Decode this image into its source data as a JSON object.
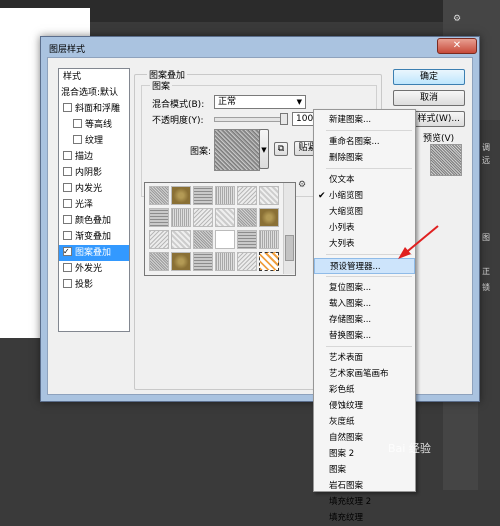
{
  "dialog": {
    "title": "图层样式",
    "close_label": "✕"
  },
  "style_list": {
    "header": "样式",
    "blend_options": "混合选项:默认",
    "items": [
      {
        "label": "斜面和浮雕",
        "checked": false
      },
      {
        "label": "等高线",
        "checked": false
      },
      {
        "label": "纹理",
        "checked": false
      },
      {
        "label": "描边",
        "checked": false
      },
      {
        "label": "内阴影",
        "checked": false
      },
      {
        "label": "内发光",
        "checked": false
      },
      {
        "label": "光泽",
        "checked": false
      },
      {
        "label": "颜色叠加",
        "checked": false
      },
      {
        "label": "渐变叠加",
        "checked": false
      },
      {
        "label": "图案叠加",
        "checked": true,
        "selected": true
      },
      {
        "label": "外发光",
        "checked": false
      },
      {
        "label": "投影",
        "checked": false
      }
    ]
  },
  "pattern_overlay": {
    "group_title": "图案叠加",
    "subgroup_title": "图案",
    "blend_mode_label": "混合模式(B):",
    "blend_mode_value": "正常",
    "opacity_label": "不透明度(Y):",
    "opacity_value": "100",
    "pattern_label": "图案:",
    "snap_button": "贴紧原"
  },
  "buttons": {
    "ok": "确定",
    "cancel": "取消",
    "new_style": "样式(W)...",
    "preview": "预览(V)"
  },
  "context_menu": {
    "items": [
      {
        "label": "新建图案...",
        "checked": false
      },
      {
        "separator": true
      },
      {
        "label": "重命名图案...",
        "checked": false
      },
      {
        "label": "删除图案",
        "checked": false
      },
      {
        "separator": true
      },
      {
        "label": "仅文本",
        "checked": false
      },
      {
        "label": "小缩览图",
        "checked": true
      },
      {
        "label": "大缩览图",
        "checked": false
      },
      {
        "label": "小列表",
        "checked": false
      },
      {
        "label": "大列表",
        "checked": false
      },
      {
        "separator": true
      },
      {
        "label": "预设管理器...",
        "checked": false,
        "highlighted": true
      },
      {
        "separator": true
      },
      {
        "label": "复位图案...",
        "checked": false
      },
      {
        "label": "载入图案...",
        "checked": false
      },
      {
        "label": "存储图案...",
        "checked": false
      },
      {
        "label": "替换图案...",
        "checked": false
      },
      {
        "separator": true
      },
      {
        "label": "艺术表面",
        "checked": false
      },
      {
        "label": "艺术家画笔画布",
        "checked": false
      },
      {
        "label": "彩色纸",
        "checked": false
      },
      {
        "label": "侵蚀纹理",
        "checked": false
      },
      {
        "label": "灰度纸",
        "checked": false
      },
      {
        "label": "自然图案",
        "checked": false
      },
      {
        "label": "图案 2",
        "checked": false
      },
      {
        "label": "图案",
        "checked": false
      },
      {
        "label": "岩石图案",
        "checked": false
      },
      {
        "label": "填充纹理 2",
        "checked": false
      },
      {
        "label": "填充纹理",
        "checked": false
      }
    ]
  },
  "background_panel": {
    "labels": [
      "调",
      "远",
      "图",
      "正",
      "锁"
    ]
  },
  "watermark": "Bai 经验",
  "colors": {
    "accent": "#3399ff",
    "arrow": "#e02020",
    "titlebar": "#aac3e0"
  }
}
